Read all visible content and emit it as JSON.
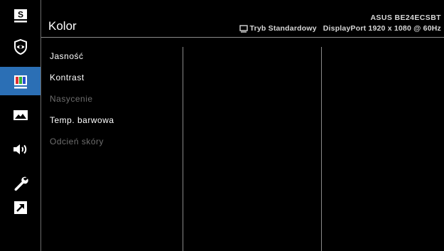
{
  "header": {
    "title": "Kolor",
    "model": "ASUS BE24ECSBT",
    "mode": "Tryb Standardowy",
    "input": "DisplayPort 1920 x 1080 @ 60Hz"
  },
  "sidebar": {
    "items": [
      {
        "icon": "splendid-s-icon",
        "active": false
      },
      {
        "icon": "eye-care-icon",
        "active": false
      },
      {
        "icon": "color-bars-icon",
        "active": true
      },
      {
        "icon": "image-icon",
        "active": false
      },
      {
        "icon": "speaker-icon",
        "active": false
      },
      {
        "icon": "wrench-icon",
        "active": false
      },
      {
        "icon": "shortcut-arrow-icon",
        "active": false
      }
    ]
  },
  "menu": {
    "items": [
      {
        "label": "Jasność",
        "enabled": true
      },
      {
        "label": "Kontrast",
        "enabled": true
      },
      {
        "label": "Nasycenie",
        "enabled": false
      },
      {
        "label": "Temp. barwowa",
        "enabled": true
      },
      {
        "label": "Odcień skóry",
        "enabled": false
      }
    ]
  },
  "colors": {
    "background": "#000000",
    "active_tab": "#2b6fb5",
    "text": "#ffffff",
    "disabled_text": "#6e6e6e"
  }
}
